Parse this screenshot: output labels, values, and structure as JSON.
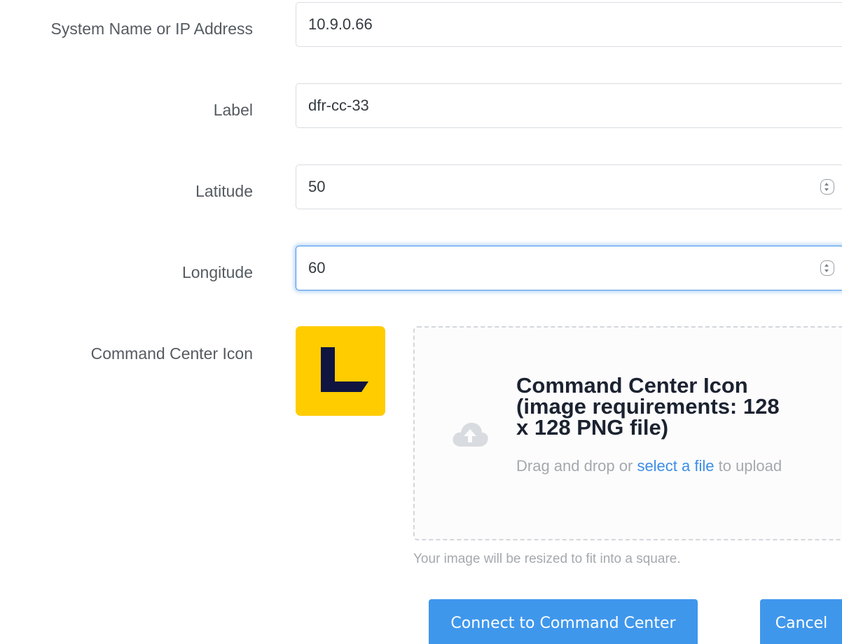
{
  "form": {
    "system_name": {
      "label": "System Name or IP Address",
      "value": "10.9.0.66"
    },
    "label_field": {
      "label": "Label",
      "value": "dfr-cc-33"
    },
    "latitude": {
      "label": "Latitude",
      "value": "50"
    },
    "longitude": {
      "label": "Longitude",
      "value": "60"
    },
    "icon": {
      "label": "Command Center Icon",
      "preview_icon": "logo-l-icon",
      "preview_letter": "L",
      "preview_bg_color": "#ffcc00",
      "preview_fg_color": "#0f1440"
    }
  },
  "dropzone": {
    "upload_icon": "cloud-upload-icon",
    "title": "Command Center Icon (image requirements: 128 x 128 PNG file)",
    "text_before": "Drag and drop or ",
    "link": "select a file",
    "text_after": " to upload",
    "hint": "Your image will be resized to fit into a square."
  },
  "buttons": {
    "connect": "Connect to Command Center",
    "cancel": "Cancel"
  },
  "colors": {
    "accent": "#3f97ec",
    "focus_border": "#4a95e8",
    "link": "#3c8de6"
  }
}
